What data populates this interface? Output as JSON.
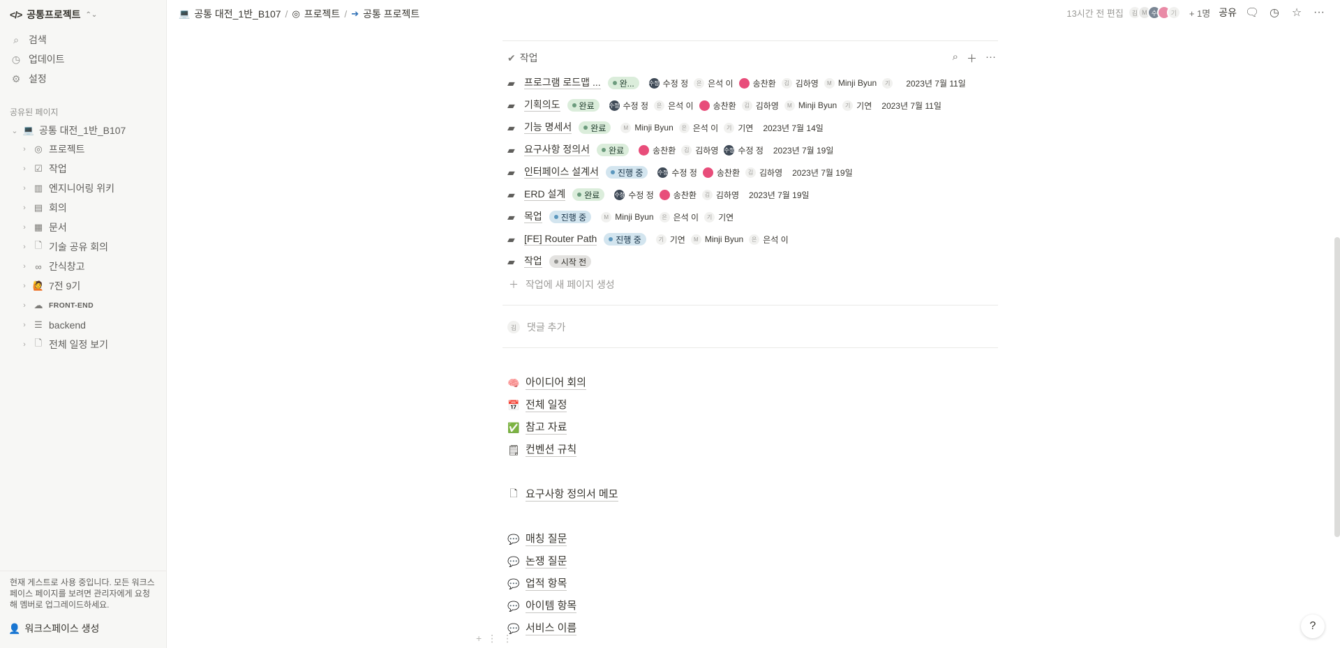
{
  "sidebar": {
    "workspace": "공통프로젝트",
    "nav": [
      {
        "icon": "search-icon",
        "label": "검색"
      },
      {
        "icon": "clock-icon",
        "label": "업데이트"
      },
      {
        "icon": "gear-icon",
        "label": "설정"
      }
    ],
    "section_label": "공유된 페이지",
    "root": {
      "icon": "laptop-icon",
      "label": "공통 대전_1반_B107"
    },
    "children": [
      {
        "icon": "target-icon",
        "label": "프로젝트"
      },
      {
        "icon": "checkbox-icon",
        "label": "작업"
      },
      {
        "icon": "notebook-icon",
        "label": "엔지니어링 위키"
      },
      {
        "icon": "meeting-icon",
        "label": "회의"
      },
      {
        "icon": "document-icon",
        "label": "문서"
      },
      {
        "icon": "page-icon",
        "label": "기술 공유 회의"
      },
      {
        "icon": "pretzel-icon",
        "label": "간식창고"
      },
      {
        "icon": "person-emoji-icon",
        "label": "7전 9기"
      },
      {
        "icon": "cloud-icon",
        "label": "FRONT-END"
      },
      {
        "icon": "server-icon",
        "label": "backend"
      },
      {
        "icon": "page-icon",
        "label": "전체 일정 보기"
      }
    ],
    "guest_note": "현재 게스트로 사용 중입니다. 모든 워크스페이스 페이지를 보려면 관리자에게 요청해 멤버로 업그레이드하세요.",
    "create_workspace": "워크스페이스 생성"
  },
  "topbar": {
    "breadcrumbs": [
      {
        "icon": "laptop-icon",
        "label": "공통 대전_1반_B107"
      },
      {
        "icon": "target-icon",
        "label": "프로젝트"
      },
      {
        "icon": "arrow-circle-icon",
        "label": "공통 프로젝트"
      }
    ],
    "edited": "13시간 전 편집",
    "avatars": [
      "김",
      "M",
      "수",
      "",
      "기"
    ],
    "more_count": "+ 1명",
    "share": "공유"
  },
  "tasks_db": {
    "title": "작업",
    "rows": [
      {
        "title": "프로그램 로드맵 ...",
        "status": "완...",
        "status_type": "done",
        "people": [
          {
            "av": "수정",
            "kind": "dark",
            "name": "수정 정"
          },
          {
            "av": "은",
            "kind": "light",
            "name": "은석 이"
          },
          {
            "av": "",
            "kind": "pink",
            "name": "송찬환"
          },
          {
            "av": "김",
            "kind": "light",
            "name": "김하영"
          },
          {
            "av": "M",
            "kind": "light",
            "name": "Minji Byun"
          },
          {
            "av": "기",
            "kind": "light",
            "name": ""
          }
        ],
        "date": "2023년 7월 11일"
      },
      {
        "title": "기획의도",
        "status": "완료",
        "status_type": "done",
        "people": [
          {
            "av": "수정",
            "kind": "dark",
            "name": "수정 정"
          },
          {
            "av": "은",
            "kind": "light",
            "name": "은석 이"
          },
          {
            "av": "",
            "kind": "pink",
            "name": "송찬환"
          },
          {
            "av": "김",
            "kind": "light",
            "name": "김하영"
          },
          {
            "av": "M",
            "kind": "light",
            "name": "Minji Byun"
          },
          {
            "av": "기",
            "kind": "light",
            "name": "기연"
          }
        ],
        "date": "2023년 7월 11일"
      },
      {
        "title": "기능 명세서",
        "status": "완료",
        "status_type": "done",
        "people": [
          {
            "av": "M",
            "kind": "light",
            "name": "Minji Byun"
          },
          {
            "av": "은",
            "kind": "light",
            "name": "은석 이"
          },
          {
            "av": "기",
            "kind": "light",
            "name": "기연"
          }
        ],
        "date": "2023년 7월 14일"
      },
      {
        "title": "요구사항 정의서",
        "status": "완료",
        "status_type": "done",
        "people": [
          {
            "av": "",
            "kind": "pink",
            "name": "송찬환"
          },
          {
            "av": "김",
            "kind": "light",
            "name": "김하영"
          },
          {
            "av": "수정",
            "kind": "dark",
            "name": "수정 정"
          }
        ],
        "date": "2023년 7월 19일"
      },
      {
        "title": "인터페이스 설계서",
        "status": "진행 중",
        "status_type": "prog",
        "people": [
          {
            "av": "수정",
            "kind": "dark",
            "name": "수정 정"
          },
          {
            "av": "",
            "kind": "pink",
            "name": "송찬환"
          },
          {
            "av": "김",
            "kind": "light",
            "name": "김하영"
          }
        ],
        "date": "2023년 7월 19일"
      },
      {
        "title": "ERD 설계",
        "status": "완료",
        "status_type": "done",
        "people": [
          {
            "av": "수정",
            "kind": "dark",
            "name": "수정 정"
          },
          {
            "av": "",
            "kind": "pink",
            "name": "송찬환"
          },
          {
            "av": "김",
            "kind": "light",
            "name": "김하영"
          }
        ],
        "date": "2023년 7월 19일"
      },
      {
        "title": "목업",
        "status": "진행 중",
        "status_type": "prog",
        "people": [
          {
            "av": "M",
            "kind": "light",
            "name": "Minji Byun"
          },
          {
            "av": "은",
            "kind": "light",
            "name": "은석 이"
          },
          {
            "av": "기",
            "kind": "light",
            "name": "기연"
          }
        ],
        "date": ""
      },
      {
        "title": "[FE] Router Path",
        "status": "진행 중",
        "status_type": "prog",
        "people": [
          {
            "av": "기",
            "kind": "light",
            "name": "기연"
          },
          {
            "av": "M",
            "kind": "light",
            "name": "Minji Byun"
          },
          {
            "av": "은",
            "kind": "light",
            "name": "은석 이"
          }
        ],
        "date": ""
      },
      {
        "title": "작업",
        "status": "시작 전",
        "status_type": "todo",
        "people": [],
        "date": ""
      }
    ],
    "new_page": "작업에 새 페이지 생성"
  },
  "comment": {
    "avatar": "김",
    "placeholder": "댓글 추가"
  },
  "links": [
    {
      "icon": "brain-icon",
      "emoji": "🧠",
      "label": "아이디어 회의"
    },
    {
      "icon": "calendar-icon",
      "emoji": "📅",
      "label": "전체 일정"
    },
    {
      "icon": "check-mark-icon",
      "emoji": "✅",
      "label": "참고 자료"
    },
    {
      "icon": "notepad-icon",
      "emoji": "🗒",
      "label": "컨벤션 규칙"
    },
    {
      "icon": "page-icon",
      "emoji": "🗋",
      "label": "요구사항 정의서 메모"
    },
    {
      "icon": "speech-bubble-icon",
      "emoji": "💬",
      "label": "매칭 질문"
    },
    {
      "icon": "speech-bubble-icon",
      "emoji": "💬",
      "label": "논쟁 질문"
    },
    {
      "icon": "speech-bubble-icon",
      "emoji": "💬",
      "label": "업적 항목"
    },
    {
      "icon": "speech-bubble-icon",
      "emoji": "💬",
      "label": "아이템 항목"
    },
    {
      "icon": "speech-bubble-icon",
      "emoji": "💬",
      "label": "서비스 이름"
    }
  ],
  "help": "?"
}
